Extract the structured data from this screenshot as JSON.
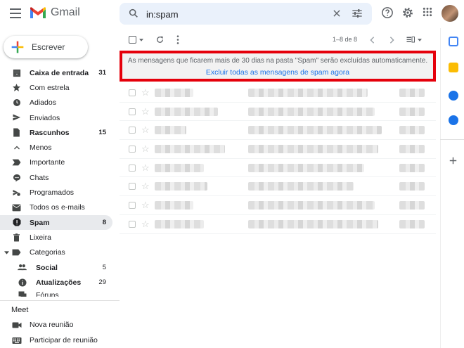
{
  "app": {
    "name": "Gmail"
  },
  "search": {
    "value": "in:spam"
  },
  "compose": {
    "label": "Escrever"
  },
  "nav": [
    {
      "label": "Caixa de entrada",
      "count": "31",
      "bold": true,
      "icon": "inbox-icon"
    },
    {
      "label": "Com estrela",
      "count": "",
      "icon": "star-icon"
    },
    {
      "label": "Adiados",
      "count": "",
      "icon": "clock-icon"
    },
    {
      "label": "Enviados",
      "count": "",
      "icon": "send-icon"
    },
    {
      "label": "Rascunhos",
      "count": "15",
      "bold": true,
      "icon": "draft-icon"
    },
    {
      "label": "Menos",
      "count": "",
      "icon": "chevron-up-icon"
    },
    {
      "label": "Importante",
      "count": "",
      "icon": "important-icon"
    },
    {
      "label": "Chats",
      "count": "",
      "icon": "chat-icon"
    },
    {
      "label": "Programados",
      "count": "",
      "icon": "scheduled-icon"
    },
    {
      "label": "Todos os e-mails",
      "count": "",
      "icon": "mail-icon"
    },
    {
      "label": "Spam",
      "count": "8",
      "bold": true,
      "active": true,
      "icon": "spam-icon"
    },
    {
      "label": "Lixeira",
      "count": "",
      "icon": "trash-icon"
    },
    {
      "label": "Categorias",
      "count": "",
      "icon": "label-icon"
    },
    {
      "label": "Social",
      "count": "5",
      "bold": true,
      "sub": true,
      "icon": "people-icon"
    },
    {
      "label": "Atualizações",
      "count": "29",
      "bold": true,
      "sub": true,
      "icon": "info-icon"
    },
    {
      "label": "Fóruns",
      "count": "",
      "sub": true,
      "icon": "forum-icon"
    }
  ],
  "meet": {
    "title": "Meet",
    "new_meeting": "Nova reunião",
    "join_meeting": "Participar de reunião"
  },
  "toolbar": {
    "pager": "1–8 de 8"
  },
  "banner": {
    "text": "As mensagens que ficarem mais de 30 dias na pasta \"Spam\" serão excluídas automaticamente.",
    "link": "Excluir todas as mensagens de spam agora"
  },
  "email_rows": 8,
  "colors": {
    "accent": "#1a73e8",
    "highlight_border": "#e5000b",
    "active_nav": "#e8eaed"
  }
}
